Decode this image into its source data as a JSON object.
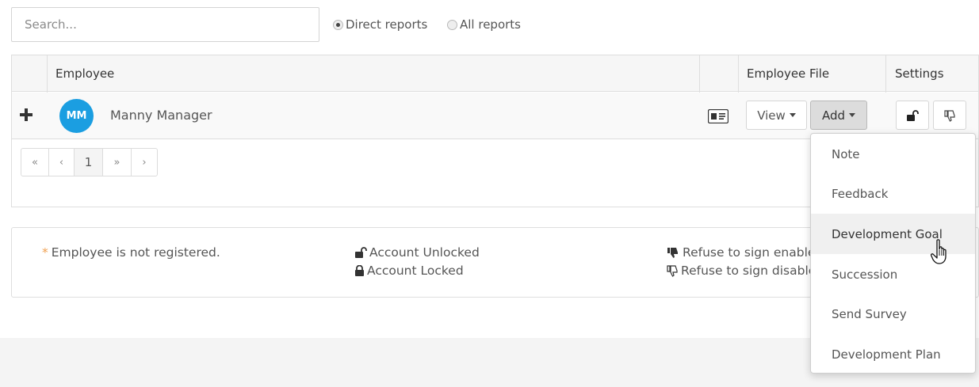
{
  "search": {
    "placeholder": "Search...",
    "value": ""
  },
  "filters": [
    {
      "label": "Direct reports",
      "selected": true
    },
    {
      "label": "All reports",
      "selected": false
    }
  ],
  "table": {
    "headers": {
      "employee": "Employee",
      "employee_file": "Employee File",
      "settings": "Settings"
    },
    "rows": [
      {
        "initials": "MM",
        "name": "Manny Manager",
        "view_label": "View",
        "add_label": "Add"
      }
    ],
    "avatar_color": "#1b9ee1"
  },
  "pagination": {
    "first": "«",
    "prev": "‹",
    "current": "1",
    "next": "»",
    "last": "›"
  },
  "legend": {
    "not_registered": "Employee is not registered.",
    "unlocked": "Account Unlocked",
    "locked": "Account Locked",
    "refuse_enabled": "Refuse to sign enable",
    "refuse_disabled": "Refuse to sign disable"
  },
  "add_menu": {
    "items": [
      "Note",
      "Feedback",
      "Development Goal",
      "Succession",
      "Send Survey",
      "Development Plan"
    ],
    "hovered": "Development Goal"
  },
  "icons": [
    "plus-icon",
    "id-card-icon",
    "unlock-icon",
    "lock-icon",
    "thumbs-down-icon",
    "thumbs-down-outline-icon",
    "hand-pointer-icon"
  ]
}
